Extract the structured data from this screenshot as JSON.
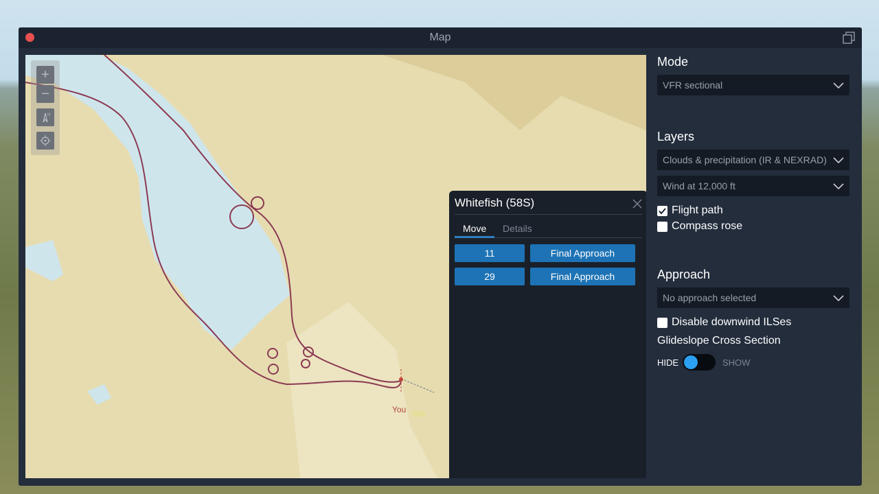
{
  "window": {
    "title": "Map"
  },
  "map": {
    "aircraft_label": "You",
    "airport_label": "58S"
  },
  "popup": {
    "title": "Whitefish (58S)",
    "tabs": [
      {
        "label": "Move"
      },
      {
        "label": "Details"
      }
    ],
    "rows": [
      {
        "runway": "11",
        "action": "Final Approach"
      },
      {
        "runway": "29",
        "action": "Final Approach"
      }
    ]
  },
  "sidebar": {
    "mode": {
      "heading": "Mode",
      "selected": "VFR sectional"
    },
    "layers": {
      "heading": "Layers",
      "dropdowns": [
        {
          "selected": "Clouds & precipitation (IR & NEXRAD)"
        },
        {
          "selected": "Wind at 12,000 ft"
        }
      ],
      "checkboxes": [
        {
          "label": "Flight path",
          "checked": true
        },
        {
          "label": "Compass rose",
          "checked": false
        }
      ]
    },
    "approach": {
      "heading": "Approach",
      "selected": "No approach selected",
      "disable_downwind_label": "Disable downwind ILSes",
      "disable_downwind_checked": false,
      "glideslope_label": "Glideslope Cross Section",
      "toggle_hide": "HIDE",
      "toggle_show": "SHOW",
      "toggle_state": "HIDE"
    }
  },
  "colors": {
    "accent": "#1d73b5",
    "toggle_knob": "#2ba0f0",
    "flight_path": "#8a3a52",
    "water": "#cfe5ec",
    "land": "#e6dcb0"
  }
}
